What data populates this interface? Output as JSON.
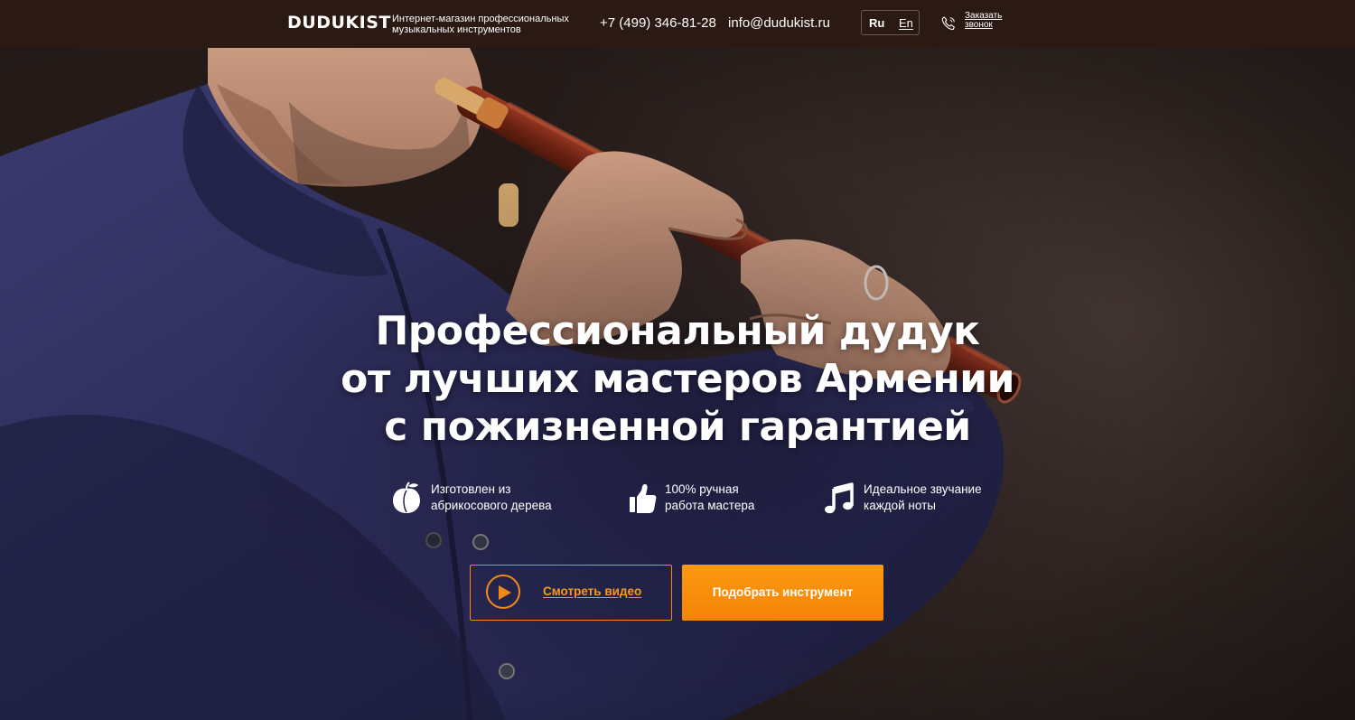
{
  "header": {
    "logo": "DUDUKIST",
    "tagline_line1": "Интернет-магазин профессиональных",
    "tagline_line2": "музыкальных инструментов",
    "phone": "+7 (499) 346-81-28",
    "email": "info@dudukist.ru",
    "lang_ru": "Ru",
    "lang_en": "En",
    "lang_selected": "Ru",
    "callback_line1": "Заказать",
    "callback_line2": "звонок",
    "callback_icon": "phone-icon"
  },
  "hero": {
    "headline_line1": "Профессиональный дудук",
    "headline_line2": "от лучших мастеров Армении",
    "headline_line3": "с пожизненной гарантией"
  },
  "features": [
    {
      "icon": "apricot-icon",
      "line1": "Изготовлен из",
      "line2": "абрикосового дерева"
    },
    {
      "icon": "thumbs-up-icon",
      "line1": "100% ручная",
      "line2": "работа мастера"
    },
    {
      "icon": "music-note-icon",
      "line1": "Идеальное звучание",
      "line2": "каждой ноты"
    }
  ],
  "buttons": {
    "video_label": "Смотреть видео",
    "video_icon": "play-icon",
    "pick_label": "Подобрать инструмент"
  },
  "colors": {
    "topbar": "#2b1913",
    "accent_orange": "#f58307",
    "text": "#ffffff"
  }
}
